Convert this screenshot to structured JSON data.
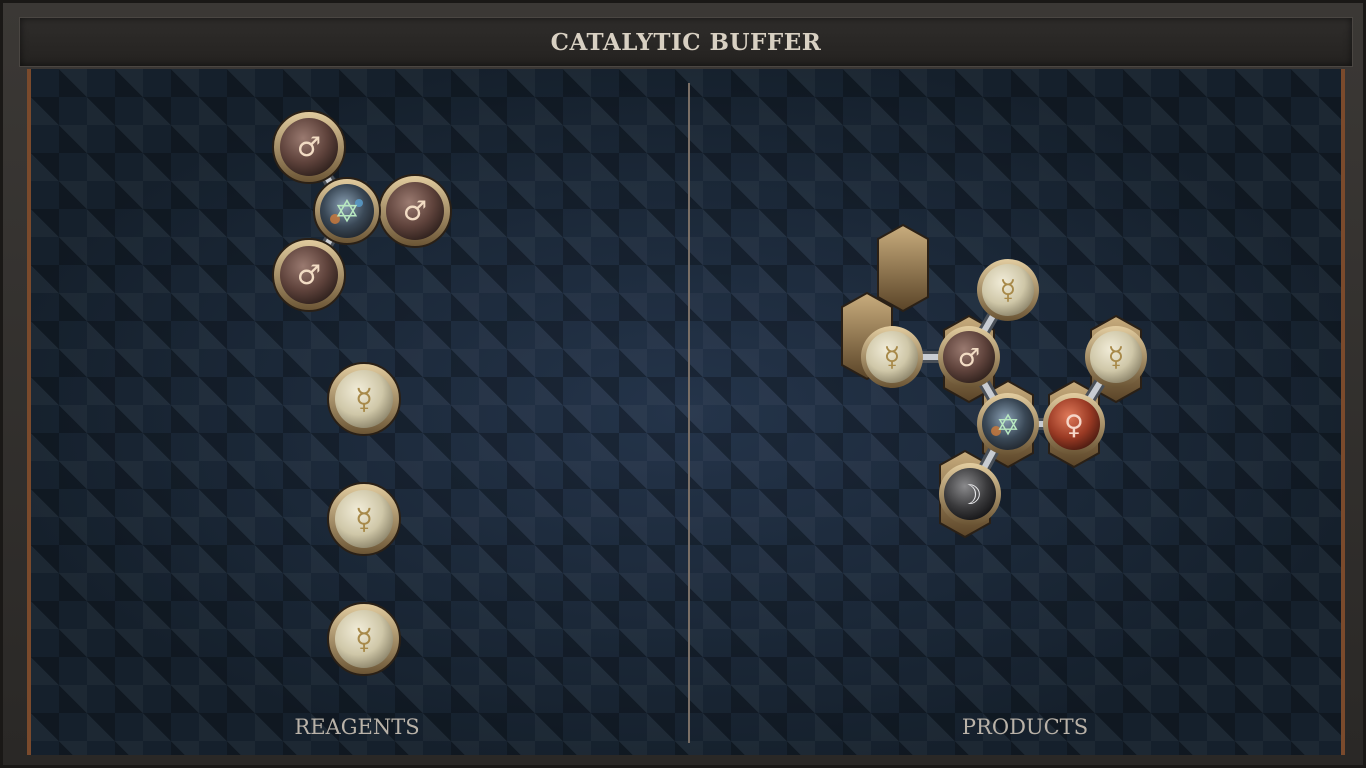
{
  "title": "CATALYTIC BUFFER",
  "reagents_label": "REAGENTS",
  "products_label": "PRODUCTS",
  "symbols": {
    "iron": "♂",
    "mercury": "☿",
    "copper": "♀",
    "silver": "☽",
    "quintessence": "✡"
  },
  "element_colors": {
    "iron": "#6e4e46",
    "mercury": "#d8d2b8",
    "copper": "#a8422a",
    "silver": "#3a3a3c",
    "quintessence": "#3a4048"
  },
  "reagents": {
    "molecule": [
      "quintessence",
      "iron",
      "iron",
      "iron"
    ],
    "single_atoms": [
      "mercury",
      "mercury",
      "mercury"
    ]
  },
  "products": {
    "molecule": [
      "mercury",
      "iron",
      "mercury",
      "quintessence",
      "copper",
      "mercury",
      "silver"
    ]
  }
}
